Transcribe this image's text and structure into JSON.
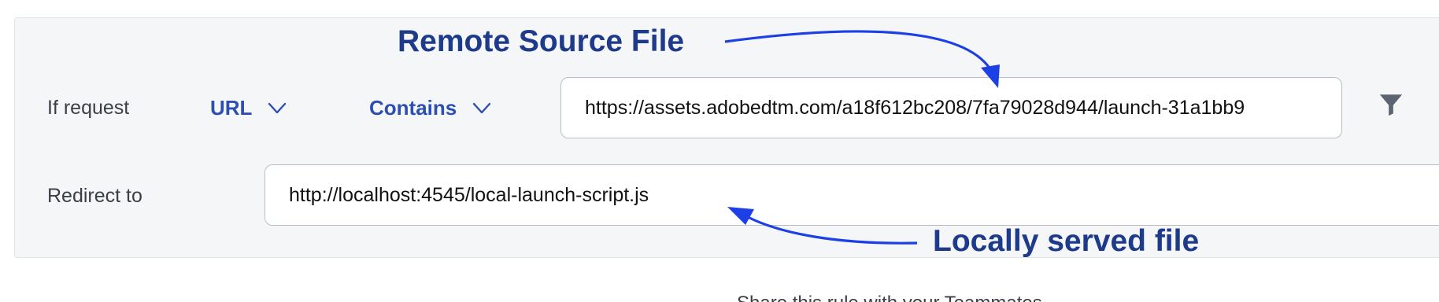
{
  "rule": {
    "if_label": "If request",
    "match_field": "URL",
    "match_operator": "Contains",
    "source_url": "https://assets.adobedtm.com/a18f612bc208/7fa79028d944/launch-31a1bb9",
    "redirect_label": "Redirect to",
    "redirect_url": "http://localhost:4545/local-launch-script.js"
  },
  "annotations": {
    "remote": "Remote Source File",
    "local": "Locally served file"
  },
  "footer": {
    "share_text": "Share this rule with your Teammates"
  },
  "icons": {
    "url_chevron": "chevron-down-icon",
    "contains_chevron": "chevron-down-icon",
    "filter": "filter-icon"
  },
  "colors": {
    "panel_bg": "#f5f6f8",
    "accent_text": "#2d4fb3",
    "annotation_text": "#1e3a8a",
    "arrow": "#1c3fe6",
    "filter_icon": "#5b6470"
  }
}
